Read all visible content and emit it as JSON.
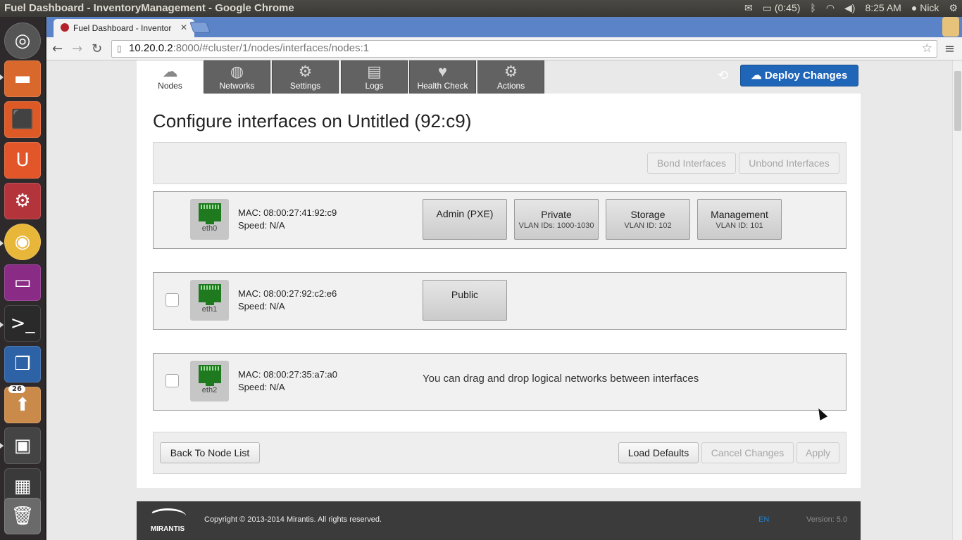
{
  "window_title": "Fuel Dashboard - InventoryManagement - Google Chrome",
  "panel": {
    "battery": "(0:45)",
    "time": "8:25 AM",
    "user": "Nick"
  },
  "launcher": {
    "badge": "26"
  },
  "browser": {
    "tab_title": "Fuel Dashboard - Inventor",
    "url_host": "10.20.0.2",
    "url_rest": ":8000/#cluster/1/nodes/interfaces/nodes:1"
  },
  "nav_tabs": [
    {
      "label": "Nodes",
      "icon": "cloud-icon"
    },
    {
      "label": "Networks",
      "icon": "globe-icon"
    },
    {
      "label": "Settings",
      "icon": "gear-icon"
    },
    {
      "label": "Logs",
      "icon": "clipboard-icon"
    },
    {
      "label": "Health Check",
      "icon": "heartbeat-icon"
    },
    {
      "label": "Actions",
      "icon": "gears-icon"
    }
  ],
  "deploy_label": "Deploy Changes",
  "page_title": "Configure interfaces on Untitled (92:c9)",
  "bond_label": "Bond Interfaces",
  "unbond_label": "Unbond Interfaces",
  "interfaces": [
    {
      "name": "eth0",
      "mac": "MAC: 08:00:27:41:92:c9",
      "speed": "Speed: N/A",
      "networks": [
        {
          "name": "Admin (PXE)",
          "sub": ""
        },
        {
          "name": "Private",
          "sub": "VLAN IDs: 1000-1030"
        },
        {
          "name": "Storage",
          "sub": "VLAN ID: 102"
        },
        {
          "name": "Management",
          "sub": "VLAN ID: 101"
        }
      ]
    },
    {
      "name": "eth1",
      "mac": "MAC: 08:00:27:92:c2:e6",
      "speed": "Speed: N/A",
      "networks": [
        {
          "name": "Public",
          "sub": ""
        }
      ]
    },
    {
      "name": "eth2",
      "mac": "MAC: 08:00:27:35:a7:a0",
      "speed": "Speed: N/A",
      "hint": "You can drag and drop logical networks between interfaces"
    }
  ],
  "actions": {
    "back": "Back To Node List",
    "load_defaults": "Load Defaults",
    "cancel": "Cancel Changes",
    "apply": "Apply"
  },
  "footer": {
    "logo_text": "MIRANTIS",
    "copyright": "Copyright © 2013-2014 Mirantis. All rights reserved.",
    "lang": "EN",
    "version": "Version: 5.0"
  }
}
